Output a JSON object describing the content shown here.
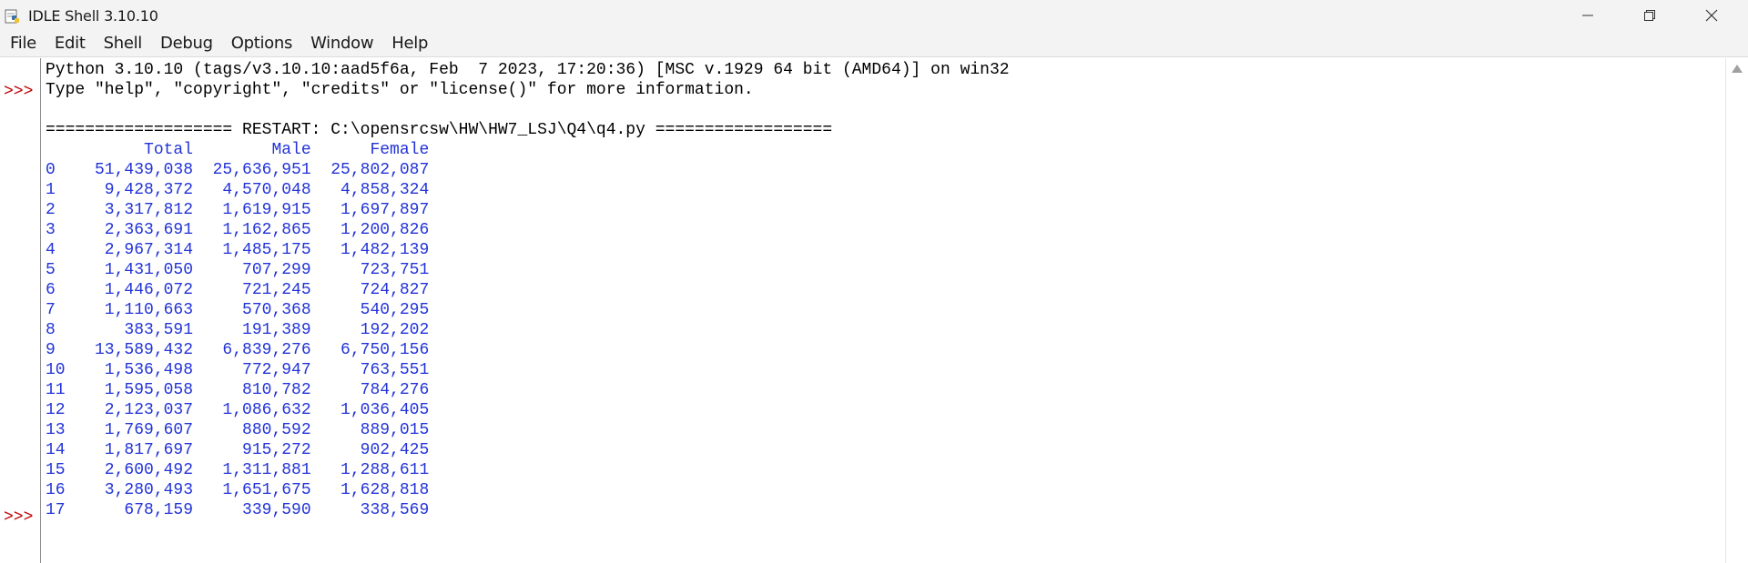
{
  "window": {
    "title": "IDLE Shell 3.10.10",
    "app_icon": "python-idle-icon",
    "controls": [
      "minimize-icon",
      "maximize-icon",
      "close-icon"
    ]
  },
  "menu": {
    "items": [
      "File",
      "Edit",
      "Shell",
      "Debug",
      "Options",
      "Window",
      "Help"
    ]
  },
  "shell": {
    "prompt": ">>>",
    "banner": [
      "Python 3.10.10 (tags/v3.10.10:aad5f6a, Feb  7 2023, 17:20:36) [MSC v.1929 64 bit (AMD64)] on win32",
      "Type \"help\", \"copyright\", \"credits\" or \"license()\" for more information."
    ],
    "restart_line": "=================== RESTART: C:\\opensrcsw\\HW\\HW7_LSJ\\Q4\\q4.py ==================",
    "table": {
      "headers": [
        "Total",
        "Male",
        "Female"
      ],
      "rows": [
        {
          "index": "0",
          "total": "51,439,038",
          "male": "25,636,951",
          "female": "25,802,087"
        },
        {
          "index": "1",
          "total": "9,428,372",
          "male": "4,570,048",
          "female": "4,858,324"
        },
        {
          "index": "2",
          "total": "3,317,812",
          "male": "1,619,915",
          "female": "1,697,897"
        },
        {
          "index": "3",
          "total": "2,363,691",
          "male": "1,162,865",
          "female": "1,200,826"
        },
        {
          "index": "4",
          "total": "2,967,314",
          "male": "1,485,175",
          "female": "1,482,139"
        },
        {
          "index": "5",
          "total": "1,431,050",
          "male": "707,299",
          "female": "723,751"
        },
        {
          "index": "6",
          "total": "1,446,072",
          "male": "721,245",
          "female": "724,827"
        },
        {
          "index": "7",
          "total": "1,110,663",
          "male": "570,368",
          "female": "540,295"
        },
        {
          "index": "8",
          "total": "383,591",
          "male": "191,389",
          "female": "192,202"
        },
        {
          "index": "9",
          "total": "13,589,432",
          "male": "6,839,276",
          "female": "6,750,156"
        },
        {
          "index": "10",
          "total": "1,536,498",
          "male": "772,947",
          "female": "763,551"
        },
        {
          "index": "11",
          "total": "1,595,058",
          "male": "810,782",
          "female": "784,276"
        },
        {
          "index": "12",
          "total": "2,123,037",
          "male": "1,086,632",
          "female": "1,036,405"
        },
        {
          "index": "13",
          "total": "1,769,607",
          "male": "880,592",
          "female": "889,015"
        },
        {
          "index": "14",
          "total": "1,817,697",
          "male": "915,272",
          "female": "902,425"
        },
        {
          "index": "15",
          "total": "2,600,492",
          "male": "1,311,881",
          "female": "1,288,611"
        },
        {
          "index": "16",
          "total": "3,280,493",
          "male": "1,651,675",
          "female": "1,628,818"
        },
        {
          "index": "17",
          "total": "678,159",
          "male": "339,590",
          "female": "338,569"
        }
      ]
    }
  },
  "colors": {
    "prompt": "#c00000",
    "stdout": "#2233d8",
    "text": "#000000",
    "chrome": "#f3f3f3"
  }
}
